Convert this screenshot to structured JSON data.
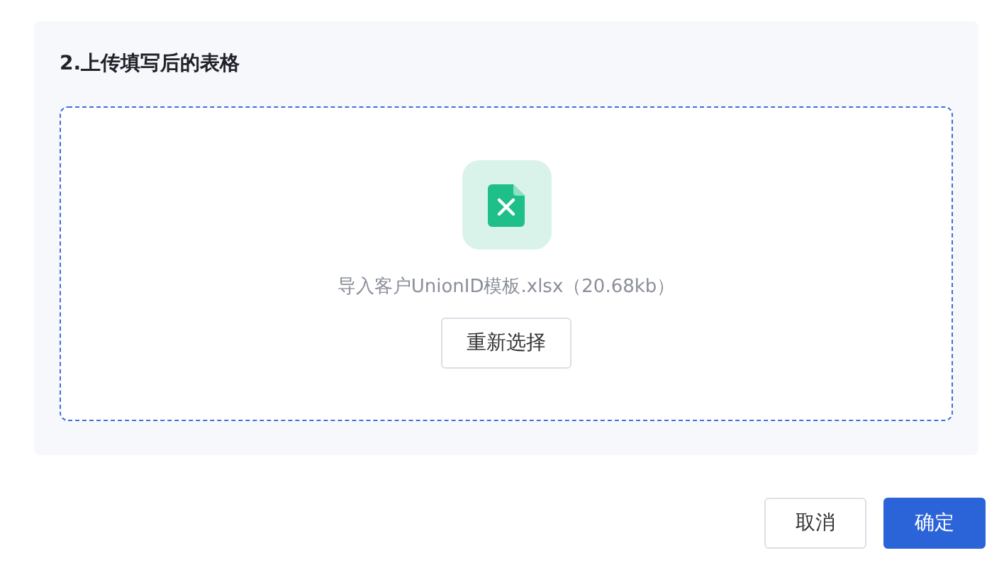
{
  "section": {
    "title": "2.上传填写后的表格"
  },
  "upload": {
    "file_name": "导入客户UnionID模板.xlsx（20.68kb）",
    "reselect_button": "重新选择"
  },
  "buttons": [
    {
      "label": "取消",
      "kind": "default"
    },
    {
      "label": "确定",
      "kind": "primary"
    }
  ]
}
